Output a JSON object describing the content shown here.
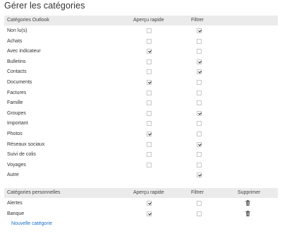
{
  "title": "Gérer les catégories",
  "outlook": {
    "headers": {
      "name": "Catégories Outlook",
      "apercu": "Aperçu rapide",
      "filtrer": "Filtrer"
    },
    "rows": [
      {
        "label": "Non lu(s)",
        "apercu": false,
        "filtrer": true
      },
      {
        "label": "Achats",
        "apercu": false,
        "filtrer": false
      },
      {
        "label": "Avec indicateur",
        "apercu": true,
        "filtrer": false
      },
      {
        "label": "Bulletins",
        "apercu": false,
        "filtrer": true
      },
      {
        "label": "Contacts",
        "apercu": false,
        "filtrer": true
      },
      {
        "label": "Documents",
        "apercu": true,
        "filtrer": false
      },
      {
        "label": "Factures",
        "apercu": false,
        "filtrer": false
      },
      {
        "label": "Famille",
        "apercu": false,
        "filtrer": false
      },
      {
        "label": "Groupes",
        "apercu": false,
        "filtrer": true
      },
      {
        "label": "Important",
        "apercu": false,
        "filtrer": false
      },
      {
        "label": "Photos",
        "apercu": true,
        "filtrer": false
      },
      {
        "label": "Réseaux sociaux",
        "apercu": false,
        "filtrer": true
      },
      {
        "label": "Suivi de colis",
        "apercu": false,
        "filtrer": false
      },
      {
        "label": "Voyages",
        "apercu": false,
        "filtrer": false
      },
      {
        "label": "Autre",
        "apercu": null,
        "filtrer": true
      }
    ]
  },
  "personal": {
    "headers": {
      "name": "Catégories personnelles",
      "apercu": "Aperçu rapide",
      "filtrer": "Filtrer",
      "supprimer": "Supprimer"
    },
    "rows": [
      {
        "label": "Alertes",
        "apercu": true,
        "filtrer": false,
        "delete_icon": "trash-icon"
      },
      {
        "label": "Banque",
        "apercu": true,
        "filtrer": false,
        "delete_icon": "trash-icon"
      }
    ]
  },
  "new_category_link": "Nouvelle catégorie",
  "colors": {
    "header_bg": "#ebebeb",
    "link": "#1a6fc7",
    "text": "#333333"
  }
}
